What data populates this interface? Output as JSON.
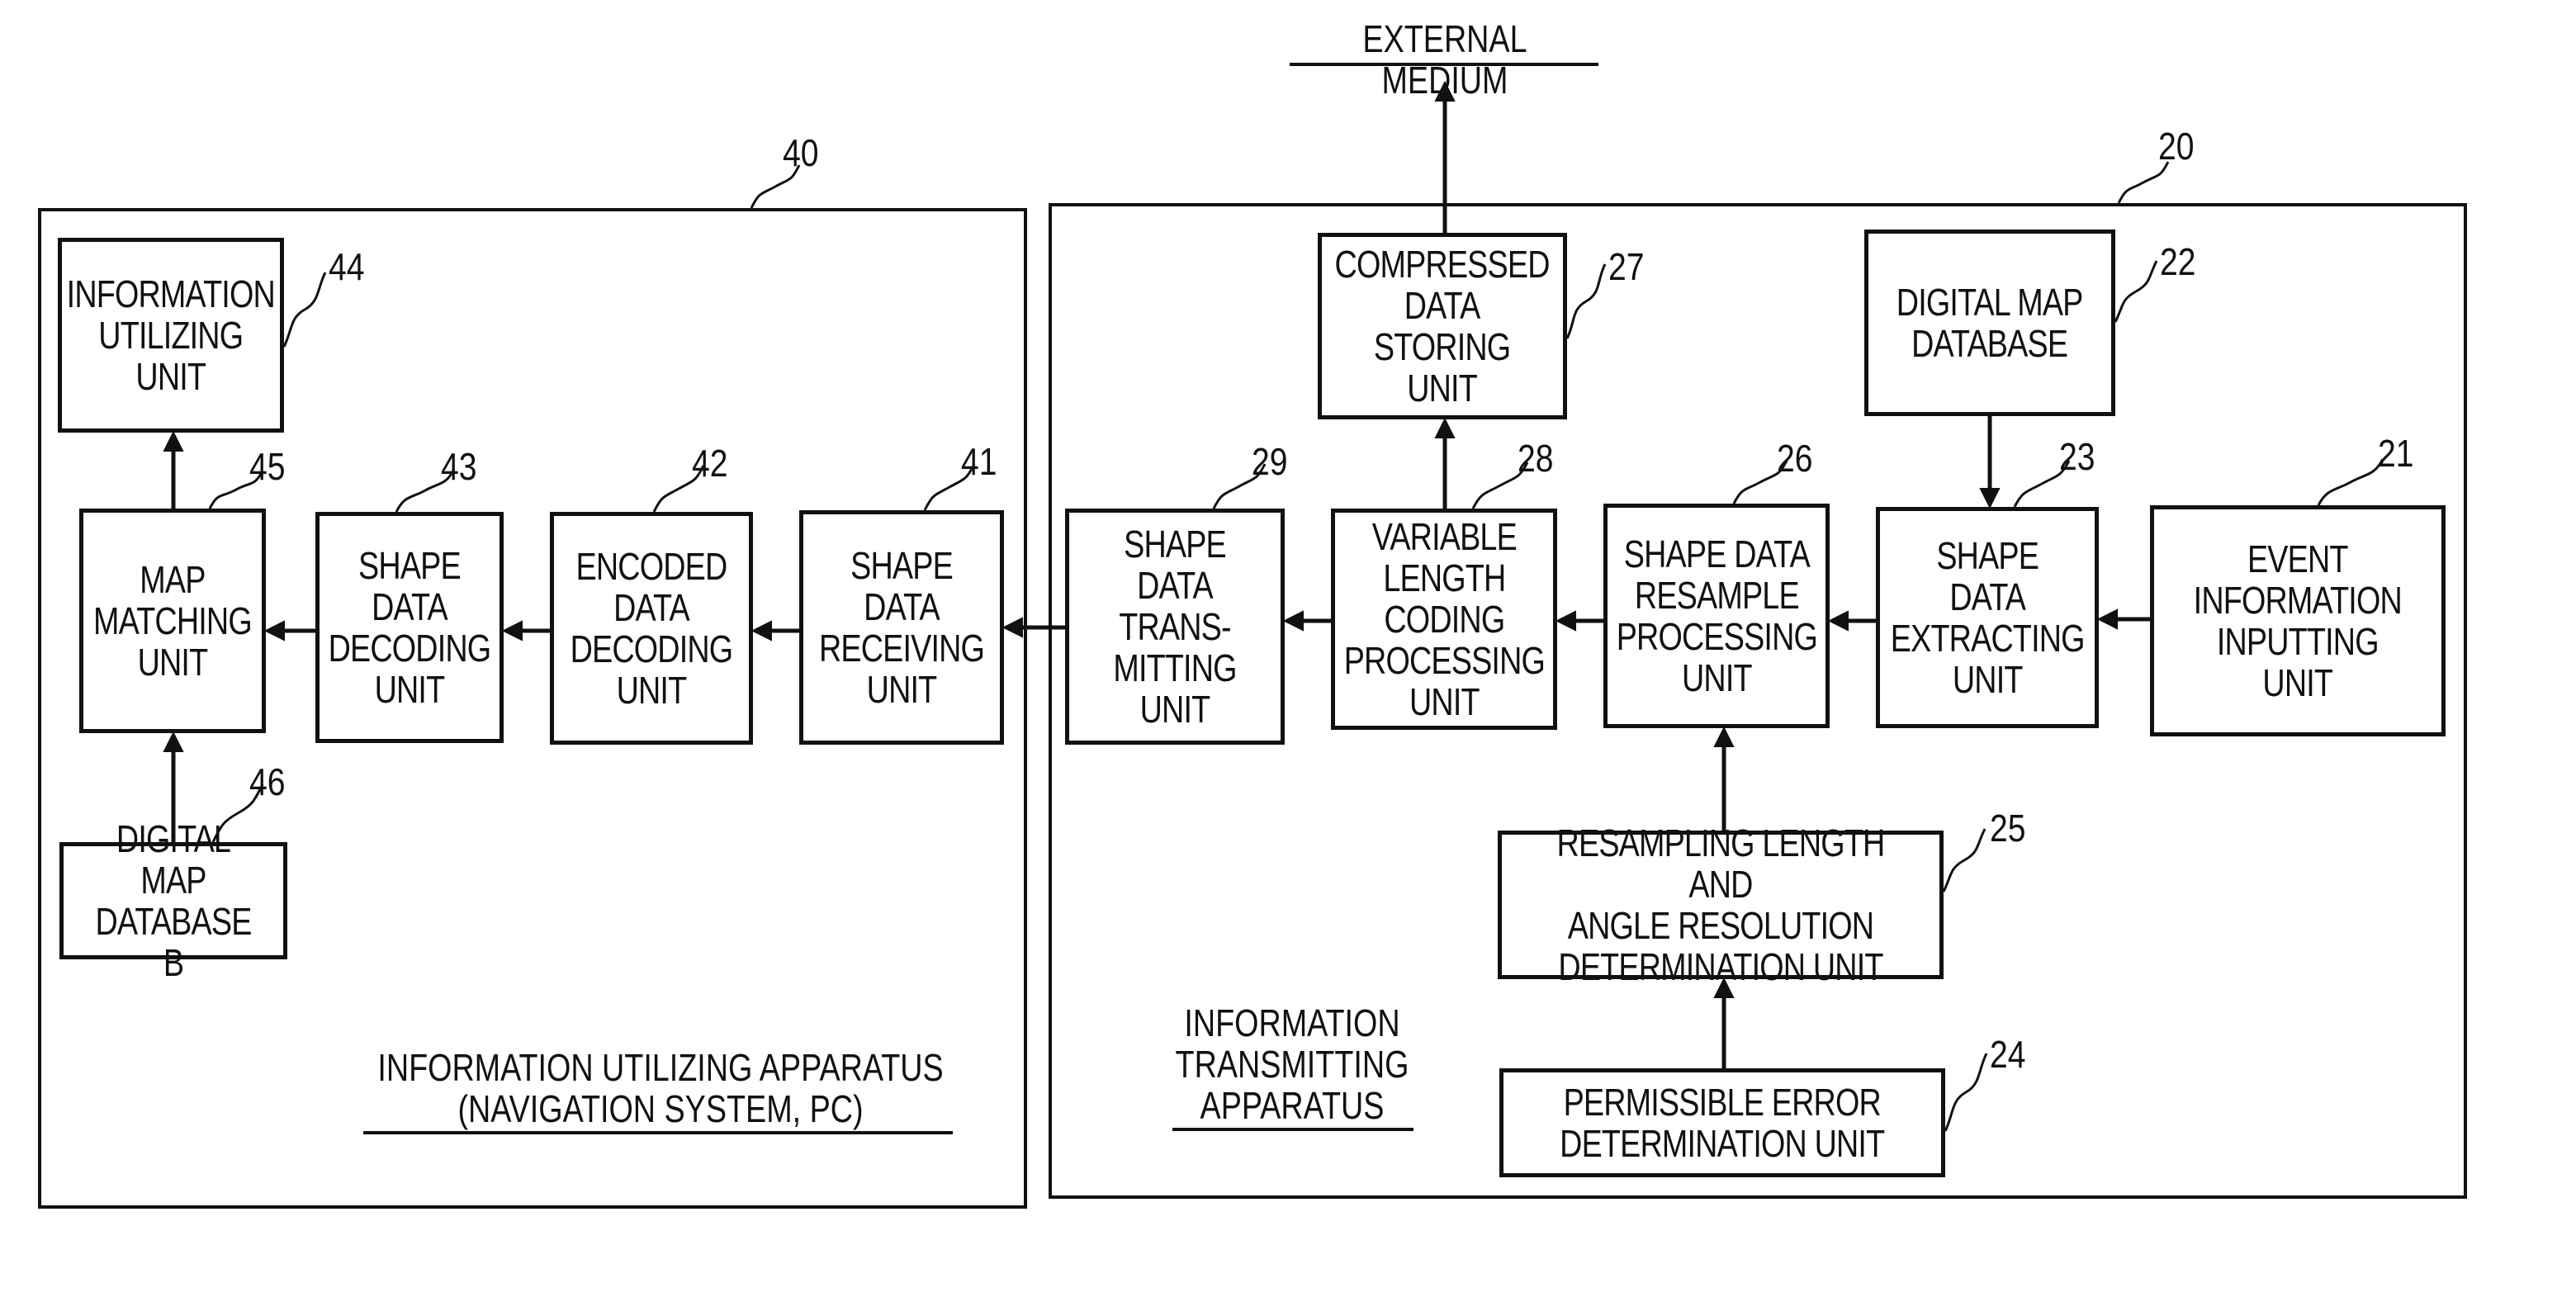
{
  "external_medium": "EXTERNAL MEDIUM",
  "apparatus": {
    "utilizing": {
      "ref": "40",
      "caption": "INFORMATION UTILIZING APPARATUS\n(NAVIGATION SYSTEM, PC)"
    },
    "transmitting": {
      "ref": "20",
      "caption": "INFORMATION\nTRANSMITTING\nAPPARATUS"
    }
  },
  "units": {
    "u21": {
      "ref": "21",
      "label": "EVENT\nINFORMATION\nINPUTTING\nUNIT"
    },
    "u22": {
      "ref": "22",
      "label": "DIGITAL MAP\nDATABASE"
    },
    "u23": {
      "ref": "23",
      "label": "SHAPE\nDATA\nEXTRACTING\nUNIT"
    },
    "u24": {
      "ref": "24",
      "label": "PERMISSIBLE ERROR\nDETERMINATION UNIT"
    },
    "u25": {
      "ref": "25",
      "label": "RESAMPLING LENGTH AND\nANGLE RESOLUTION\nDETERMINATION UNIT"
    },
    "u26": {
      "ref": "26",
      "label": "SHAPE DATA\nRESAMPLE\nPROCESSING\nUNIT"
    },
    "u27": {
      "ref": "27",
      "label": "COMPRESSED\nDATA\nSTORING\nUNIT"
    },
    "u28": {
      "ref": "28",
      "label": "VARIABLE\nLENGTH\nCODING\nPROCESSING\nUNIT"
    },
    "u29": {
      "ref": "29",
      "label": "SHAPE DATA\nTRANS-\nMITTING\nUNIT"
    },
    "u41": {
      "ref": "41",
      "label": "SHAPE\nDATA\nRECEIVING\nUNIT"
    },
    "u42": {
      "ref": "42",
      "label": "ENCODED\nDATA\nDECODING\nUNIT"
    },
    "u43": {
      "ref": "43",
      "label": "SHAPE\nDATA\nDECODING\nUNIT"
    },
    "u44": {
      "ref": "44",
      "label": "INFORMATION\nUTILIZING\nUNIT"
    },
    "u45": {
      "ref": "45",
      "label": "MAP\nMATCHING\nUNIT"
    },
    "u46": {
      "ref": "46",
      "label": "DIGITAL MAP\nDATABASE B"
    }
  },
  "connections": [
    {
      "from": "21",
      "to": "23"
    },
    {
      "from": "22",
      "to": "23"
    },
    {
      "from": "23",
      "to": "26"
    },
    {
      "from": "24",
      "to": "25"
    },
    {
      "from": "25",
      "to": "26"
    },
    {
      "from": "26",
      "to": "28"
    },
    {
      "from": "28",
      "to": "27"
    },
    {
      "from": "27",
      "to": "EXTERNAL MEDIUM"
    },
    {
      "from": "28",
      "to": "29"
    },
    {
      "from": "29",
      "to": "41"
    },
    {
      "from": "41",
      "to": "42"
    },
    {
      "from": "42",
      "to": "43"
    },
    {
      "from": "43",
      "to": "45"
    },
    {
      "from": "46",
      "to": "45"
    },
    {
      "from": "45",
      "to": "44"
    }
  ]
}
